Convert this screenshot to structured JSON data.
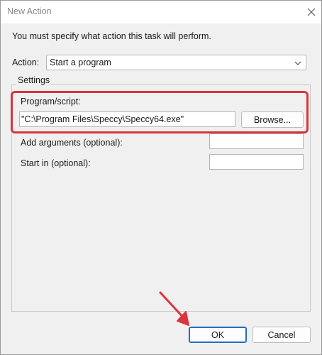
{
  "window": {
    "title": "New Action",
    "close_icon": "close-icon"
  },
  "dialog": {
    "instruction": "You must specify what action this task will perform."
  },
  "action": {
    "label": "Action:",
    "selected": "Start a program"
  },
  "settings": {
    "group_label": "Settings",
    "program_label": "Program/script:",
    "program_value": "\"C:\\Program Files\\Speccy\\Speccy64.exe\"",
    "browse_label": "Browse...",
    "args_label": "Add arguments (optional):",
    "args_value": "",
    "start_label": "Start in (optional):",
    "start_value": ""
  },
  "buttons": {
    "ok": "OK",
    "cancel": "Cancel"
  },
  "colors": {
    "highlight": "#d9353c",
    "arrow": "#d9353c",
    "default_button_border": "#1f6fc5"
  }
}
